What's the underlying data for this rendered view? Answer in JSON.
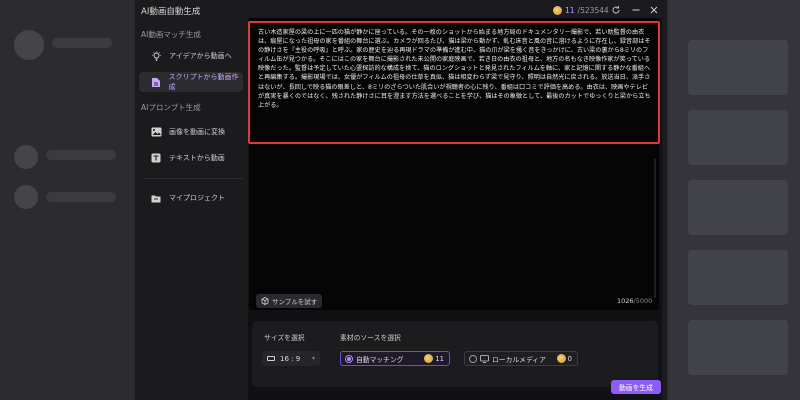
{
  "window": {
    "title": "AI動画自動生成",
    "credits_used": "11",
    "credits_total": "/523544"
  },
  "sidebar": {
    "section1_title": "AI動画マッチ生成",
    "section1_items": [
      {
        "label": "アイデアから動画へ",
        "icon": "lightbulb-icon"
      },
      {
        "label": "スクリプトから動画作成",
        "icon": "script-icon",
        "active": true
      }
    ],
    "section2_title": "AIプロンプト生成",
    "section2_items": [
      {
        "label": "画像を動画に変換",
        "icon": "image-icon"
      },
      {
        "label": "テキストから動画",
        "icon": "text-icon"
      }
    ],
    "project_label": "マイプロジェクト"
  },
  "editor": {
    "script_text": "古い木造家屋の梁の上に一匹の猫が静かに座っている。その一枚のショットから始まる地方局のドキュメンタリー撮影で、若い助監督の由衣は、痕屋になった祖母の家を番組の舞台に選ぶ。カメラが回るたび、猫は梁から動かず、軋む床音と風の音に溶けるように存在し、録音部はその静けさを『主役の呼吸』と呼ぶ。家の歴史を辿る再現ドラマの準備が進む中、猫の爪が梁を掻く音をきっかけに、古い梁の裏から8ミリのフィルム缶が見つかる。そこにはこの家を舞台に撮影された未公開の家庭映画で、若き日の由衣の祖母と、地方の名もなき映像作家が笑っている映像だった。監督は予定していた心霊探訪的な構成を捨て、猫のロングショットと発見されたフィルムを軸に、家と記憶に関する静かな番組へと再編集する。撮影現場では、女優がフィルムの祖母の仕草を真似、猫は相変わらず梁で見守り、照明は自然光に戻される。放送当日、派手さはないが、長回しで映る猫の眼差しと、8ミリのざらついた肌合いが視聴者の心に残り、番組は口コミで評価を高める。由衣は、映画やテレビが真実を暴くのではなく、残された静けさに耳を澄ます方法を選べることを学び、猫はその象徴として、最後のカットでゆっくりと梁から立ち上がる。",
    "sample_button": "サンプルを試す",
    "char_count": "1026",
    "char_max": "/5000"
  },
  "settings": {
    "size_label": "サイズを選択",
    "size_value": "16 : 9",
    "source_label": "素材のソースを選択",
    "options": [
      {
        "label": "自動マッチング",
        "cost": "11",
        "selected": true
      },
      {
        "label": "ローカルメディア",
        "cost": "0",
        "selected": false
      }
    ]
  },
  "generate_button": "動画を生成",
  "colors": {
    "accent": "#8b5cf6",
    "highlight": "#e0383a",
    "active_text": "#c7a7ff"
  }
}
